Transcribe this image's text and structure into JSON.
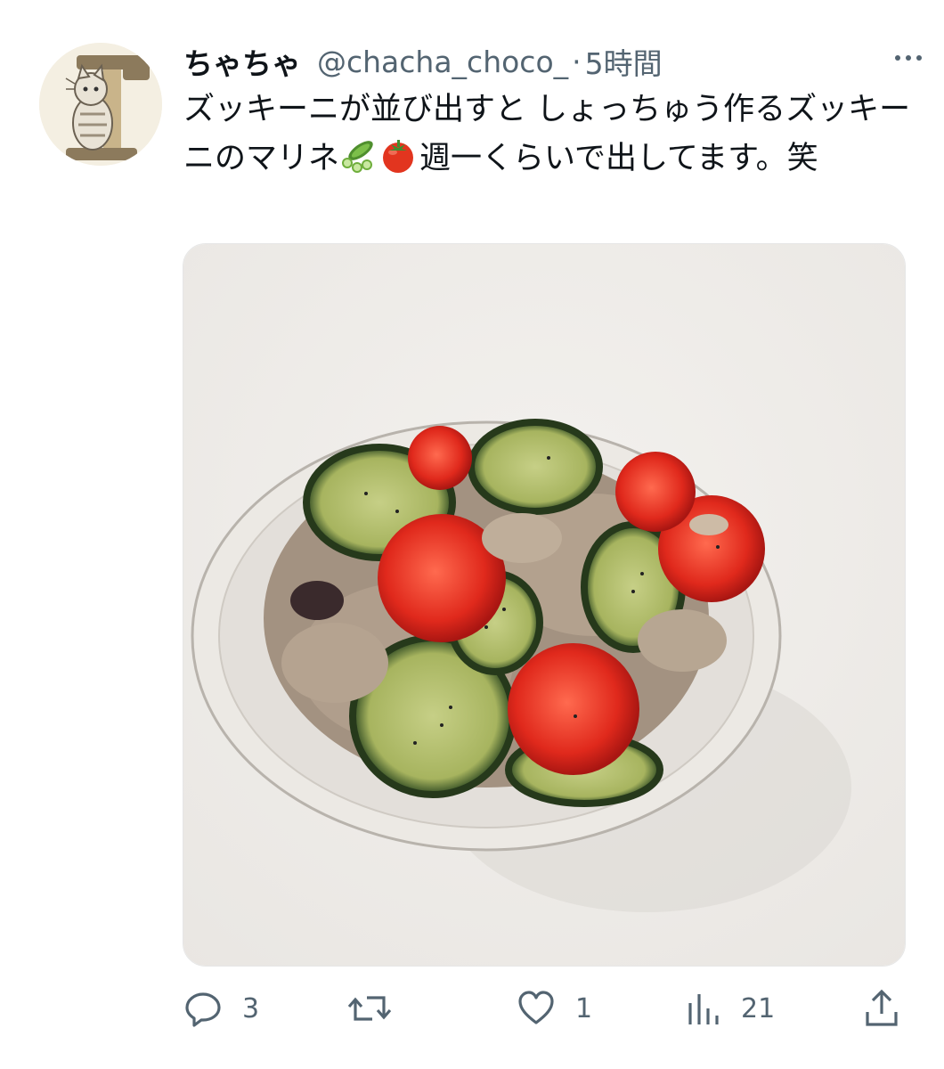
{
  "tweet": {
    "display_name": "ちゃちゃ",
    "handle": "@chacha_choco_",
    "separator": "·",
    "time": "5時間",
    "text_part1": "ズッキーニが並び出すと しょっちゅう作るズッキーニのマリネ",
    "text_part2": "週一くらいで出してます。笑",
    "emojis": [
      "cucumber-icon",
      "tomato-icon"
    ]
  },
  "media": {
    "alt": "Zucchini and cherry tomato marinade with tuna in a glass bowl"
  },
  "actions": {
    "reply_count": "3",
    "retweet_count": "",
    "like_count": "1",
    "views_count": "21"
  },
  "colors": {
    "text": "#0f1419",
    "secondary": "#536471",
    "icon": "#536471"
  }
}
